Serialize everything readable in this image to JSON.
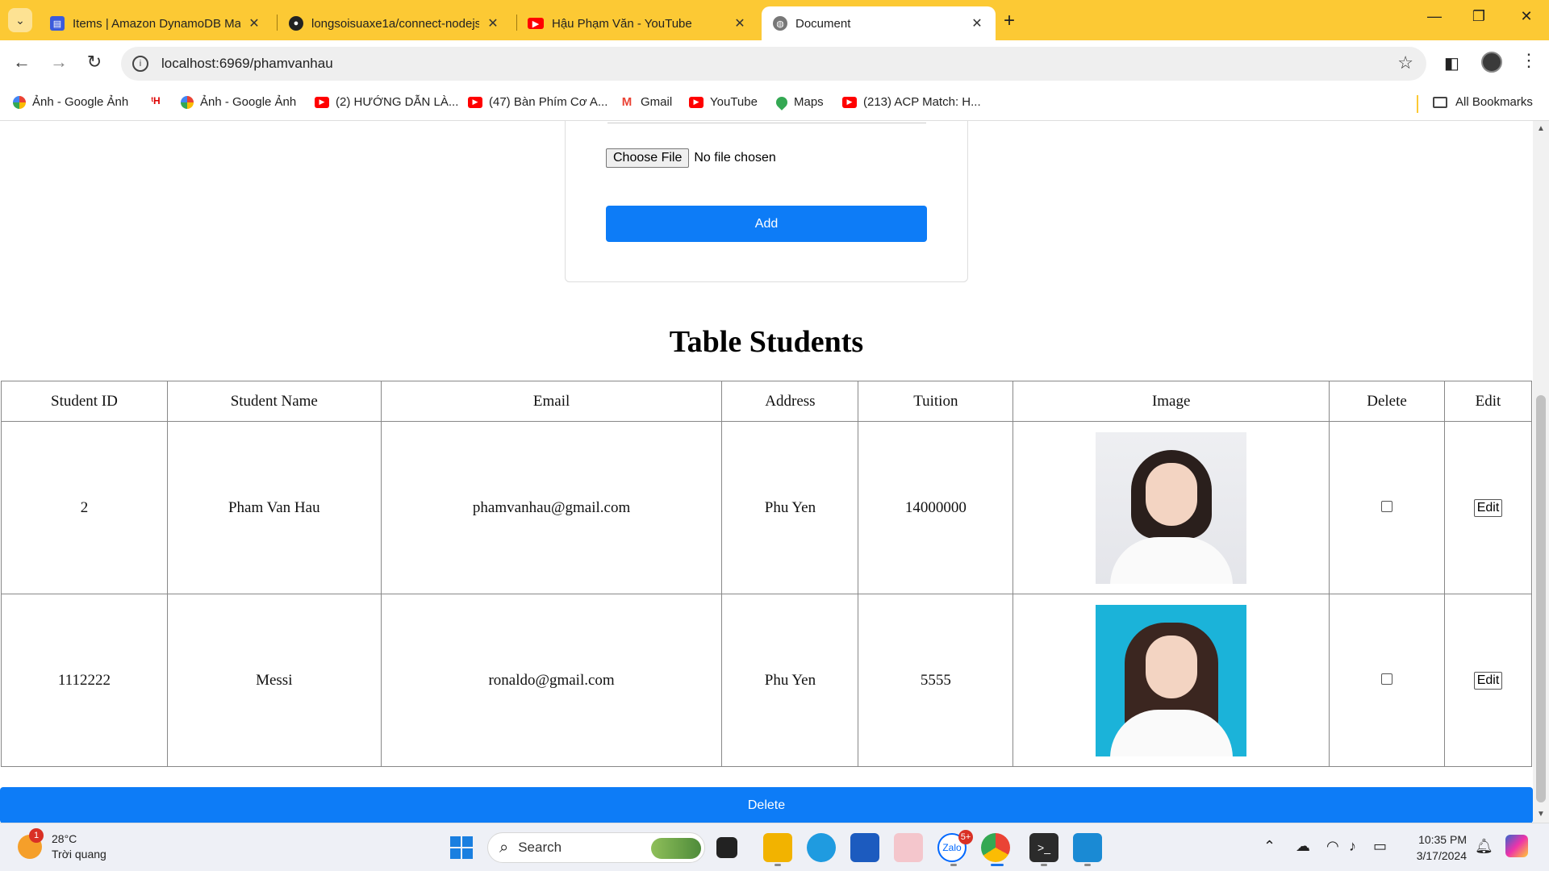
{
  "browser": {
    "tabs": [
      {
        "title": "Items | Amazon DynamoDB Ma",
        "icon": "dynamodb-icon"
      },
      {
        "title": "longsoisuaxe1a/connect-nodejs",
        "icon": "github-icon"
      },
      {
        "title": "Hậu Phạm Văn - YouTube",
        "icon": "youtube-icon"
      },
      {
        "title": "Document",
        "icon": "globe-icon"
      }
    ],
    "url": "localhost:6969/phamvanhau",
    "bookmarks": [
      {
        "label": "Ảnh - Google Ảnh"
      },
      {
        "label": ""
      },
      {
        "label": "Ảnh - Google Ảnh"
      },
      {
        "label": "(2) HƯỚNG DẪN LÀ..."
      },
      {
        "label": "(47) Bàn Phím Cơ A..."
      },
      {
        "label": "Gmail"
      },
      {
        "label": "YouTube"
      },
      {
        "label": "Maps"
      },
      {
        "label": "(213) ACP Match: H..."
      }
    ],
    "all_bookmarks": "All Bookmarks"
  },
  "form": {
    "choose_file": "Choose File",
    "no_file": "No file chosen",
    "add_label": "Add"
  },
  "table": {
    "title": "Table Students",
    "headers": [
      "Student ID",
      "Student Name",
      "Email",
      "Address",
      "Tuition",
      "Image",
      "Delete",
      "Edit"
    ],
    "rows": [
      {
        "id": "2",
        "name": "Pham Van Hau",
        "email": "phamvanhau@gmail.com",
        "address": "Phu Yen",
        "tuition": "14000000",
        "edit": "Edit"
      },
      {
        "id": "1112222",
        "name": "Messi",
        "email": "ronaldo@gmail.com",
        "address": "Phu Yen",
        "tuition": "5555",
        "edit": "Edit"
      }
    ]
  },
  "delete_label": "Delete",
  "taskbar": {
    "weather_temp": "28°C",
    "weather_desc": "Trời quang",
    "weather_badge": "1",
    "search_placeholder": "Search",
    "zalo_badge": "5+",
    "time": "10:35 PM",
    "date": "3/17/2024"
  },
  "colors": {
    "accent": "#0d7cf7",
    "tabstrip": "#fcc934"
  }
}
